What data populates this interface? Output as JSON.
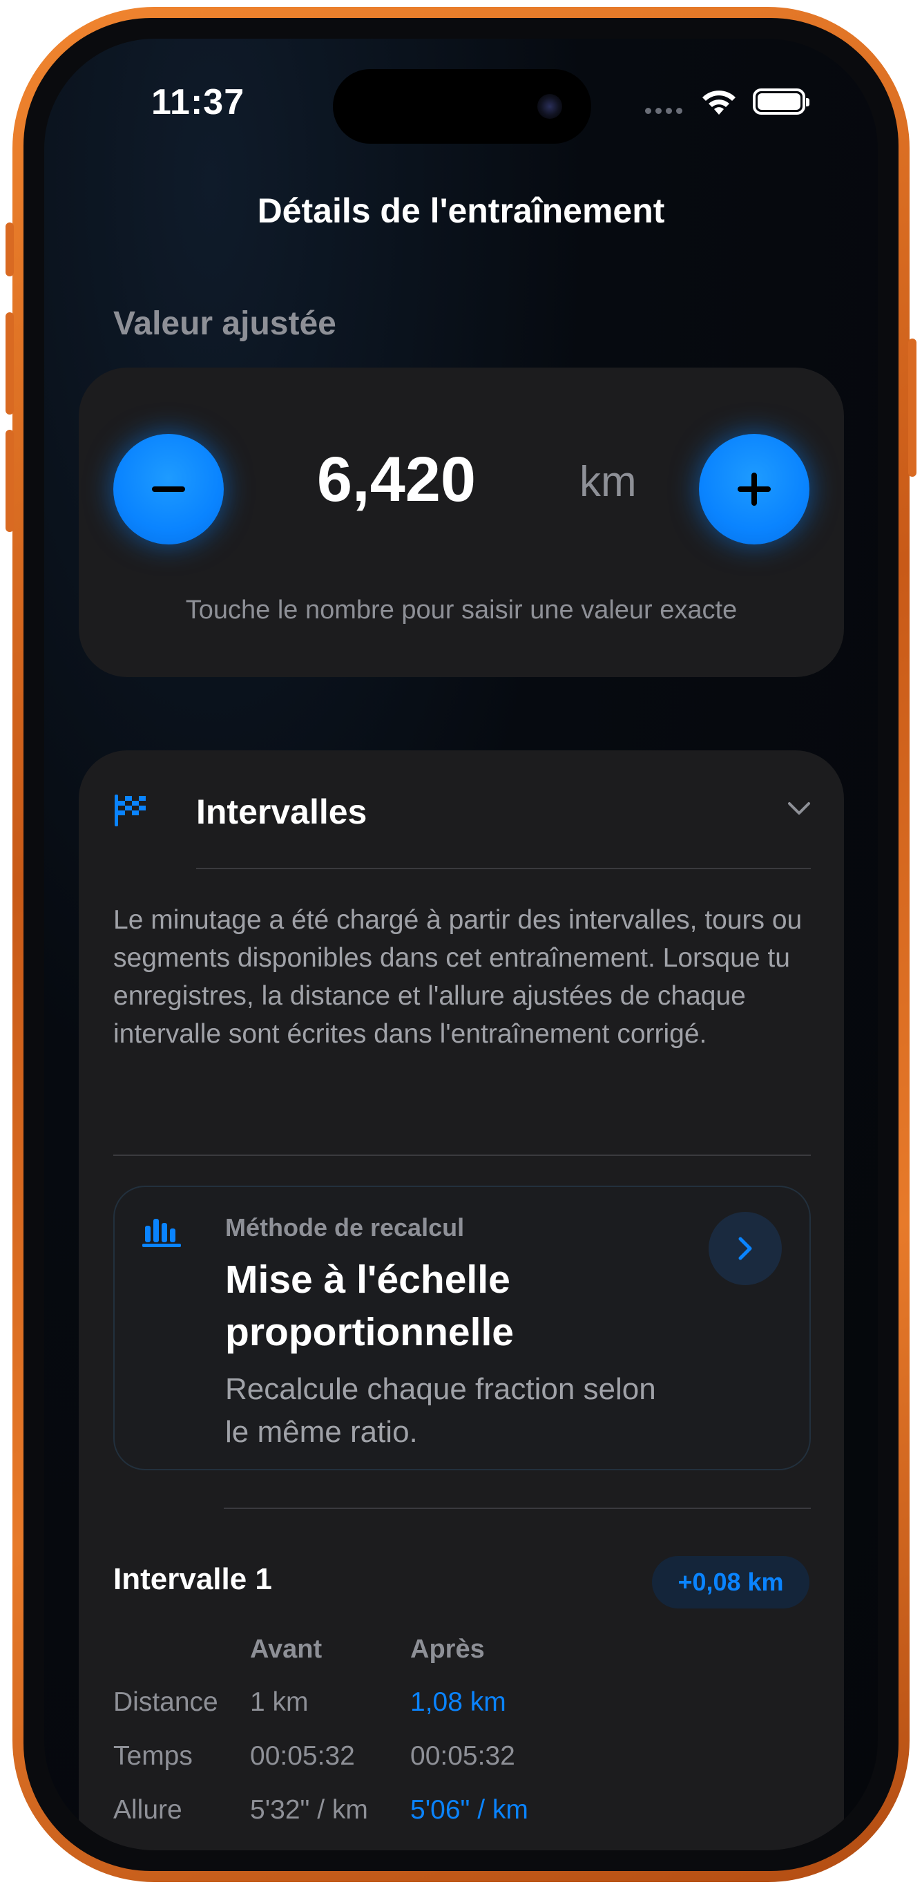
{
  "status_bar": {
    "time": "11:37"
  },
  "nav": {
    "title": "Détails de l'entraînement"
  },
  "adjust": {
    "section_label": "Valeur ajustée",
    "value": "6,420",
    "unit": "km",
    "hint": "Touche le nombre pour saisir une valeur exacte"
  },
  "intervals": {
    "title": "Intervalles",
    "description": "Le minutage a été chargé à partir des intervalles, tours ou segments disponibles dans cet entraînement. Lorsque tu enregistres, la distance et l'allure ajustées de chaque intervalle sont écrites dans l'entraînement corrigé.",
    "method": {
      "label": "Méthode de recalcul",
      "title": "Mise à l'échelle proportionnelle",
      "description": "Recalcule chaque fraction selon le même ratio."
    },
    "interval": {
      "name": "Intervalle 1",
      "delta_badge": "+0,08 km",
      "headers": {
        "before": "Avant",
        "after": "Après"
      },
      "rows": [
        {
          "label": "Distance",
          "before": "1 km",
          "after": "1,08 km",
          "after_highlight": true
        },
        {
          "label": "Temps",
          "before": "00:05:32",
          "after": "00:05:32",
          "after_highlight": false
        },
        {
          "label": "Allure",
          "before": "5'32\" / km",
          "after": "5'06\" / km",
          "after_highlight": true
        }
      ]
    }
  },
  "colors": {
    "accent": "#0a84ff",
    "card": "#1c1c1e",
    "frame": "#e0772a"
  }
}
